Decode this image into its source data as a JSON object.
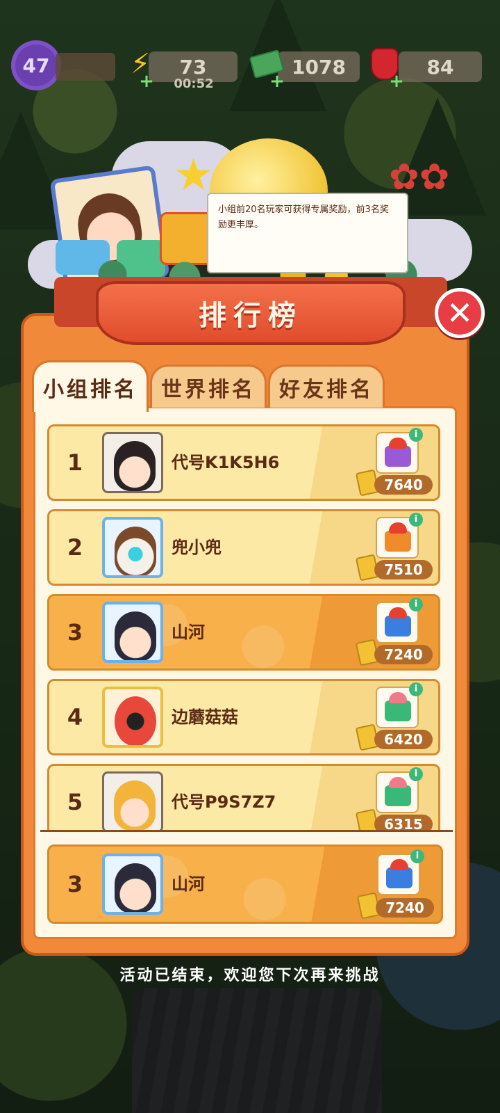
{
  "status_bar": {
    "level": "47",
    "energy": "73",
    "energy_timer": "00:52",
    "cash": "1078",
    "gems": "84",
    "icons": {
      "energy": "lightning-icon",
      "cash": "cash-icon",
      "gems": "ruby-icon"
    }
  },
  "notice": {
    "text": "小组前20名玩家可获得专属奖励，前3名奖励更丰厚。"
  },
  "title": "排行榜",
  "tabs": [
    {
      "label": "小组排名",
      "active": true
    },
    {
      "label": "世界排名",
      "active": false
    },
    {
      "label": "好友排名",
      "active": false
    }
  ],
  "rows": [
    {
      "rank": "1",
      "name": "代号K1K5H6",
      "score": "7640",
      "highlight": false,
      "gift_color": "#9a5ad6",
      "bow_color": "#e8402e"
    },
    {
      "rank": "2",
      "name": "兜小兜",
      "score": "7510",
      "highlight": false,
      "gift_color": "#f08a2a",
      "bow_color": "#e8402e"
    },
    {
      "rank": "3",
      "name": "山河",
      "score": "7240",
      "highlight": true,
      "gift_color": "#3a7ee0",
      "bow_color": "#e8402e"
    },
    {
      "rank": "4",
      "name": "边蘑菇菇",
      "score": "6420",
      "highlight": false,
      "gift_color": "#3ab878",
      "bow_color": "#f07a8a"
    },
    {
      "rank": "5",
      "name": "代号P9S7Z7",
      "score": "6315",
      "highlight": false,
      "gift_color": "#3ab878",
      "bow_color": "#f07a8a"
    }
  ],
  "my_rank": {
    "rank": "3",
    "name": "山河",
    "score": "7240"
  },
  "footer": "活动已结束，欢迎您下次再来挑战",
  "colors": {
    "panel": "#f08a3a",
    "banner": "#e04c2c",
    "close": "#e83d45",
    "row_highlight": "#f7b04a"
  }
}
